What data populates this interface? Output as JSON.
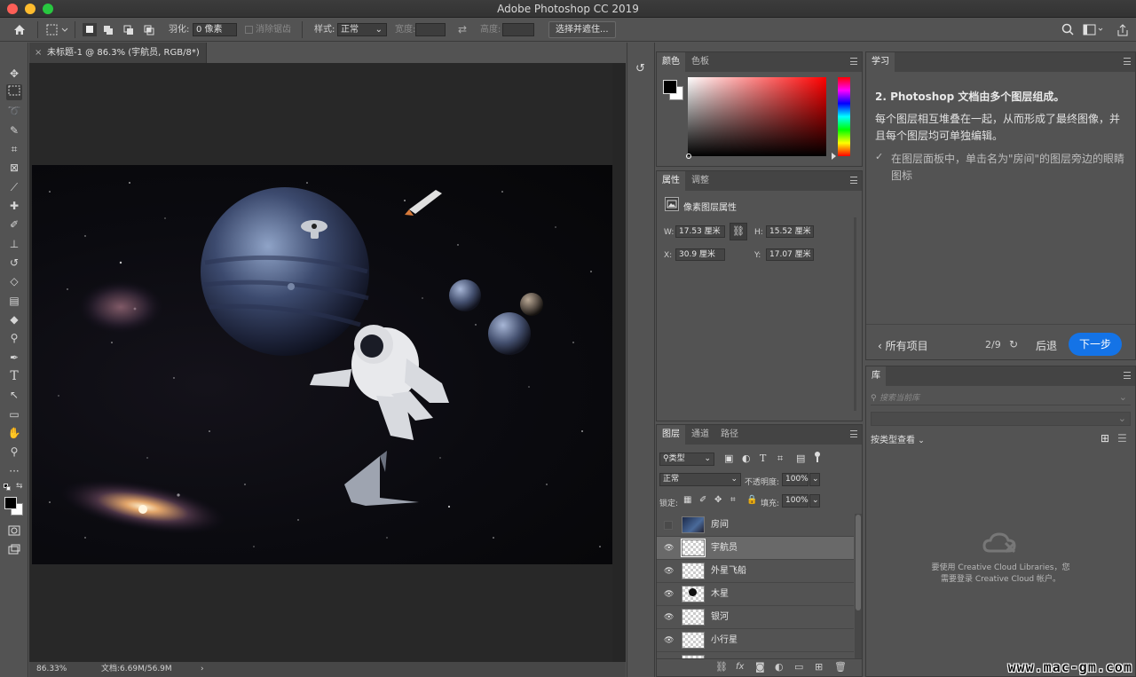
{
  "window": {
    "title": "Adobe Photoshop CC 2019"
  },
  "options": {
    "feather_label": "羽化:",
    "feather_value": "0 像素",
    "antialias_label": "消除锯齿",
    "style_label": "样式:",
    "style_value": "正常",
    "width_label": "宽度:",
    "height_label": "高度:",
    "select_mask_button": "选择并遮住..."
  },
  "document": {
    "tab_title": "未标题-1 @ 86.3% (宇航员, RGB/8*) *",
    "zoom": "86.33%",
    "doc_info": "文档:6.69M/56.9M"
  },
  "color_panel": {
    "tabs": [
      "颜色",
      "色板"
    ],
    "foreground": "#000000",
    "background": "#ffffff",
    "field_hue": "#ff0000"
  },
  "properties_panel": {
    "tabs": [
      "属性",
      "调整"
    ],
    "section_title": "像素图层属性",
    "w_label": "W:",
    "w_value": "17.53 厘米",
    "h_label": "H:",
    "h_value": "15.52 厘米",
    "x_label": "X:",
    "x_value": "30.9 厘米",
    "y_label": "Y:",
    "y_value": "17.07 厘米"
  },
  "layers_panel": {
    "tabs": [
      "图层",
      "通道",
      "路径"
    ],
    "filter_kind": "类型",
    "blend_mode": "正常",
    "opacity_label": "不透明度:",
    "opacity_value": "100%",
    "lock_label": "锁定:",
    "fill_label": "填充:",
    "fill_value": "100%",
    "layers": [
      {
        "name": "房间",
        "visible": false,
        "selected": false
      },
      {
        "name": "宇航员",
        "visible": true,
        "selected": true
      },
      {
        "name": "外星飞船",
        "visible": true,
        "selected": false
      },
      {
        "name": "木星",
        "visible": true,
        "selected": false
      },
      {
        "name": "银河",
        "visible": true,
        "selected": false
      },
      {
        "name": "小行星",
        "visible": true,
        "selected": false
      }
    ]
  },
  "learn_panel": {
    "tab": "学习",
    "step_title": "2.  Photoshop 文档由多个图层组成。",
    "body": "每个图层相互堆叠在一起，从而形成了最终图像，并且每个图层均可单独编辑。",
    "task": "在图层面板中，单击名为\"房间\"的图层旁边的眼睛图标",
    "all_items": "所有项目",
    "progress": "2/9",
    "back": "后退",
    "next": "下一步"
  },
  "library_panel": {
    "tab": "库",
    "search_placeholder": "搜索当前库",
    "view_by": "按类型查看",
    "signin_line1": "要使用 Creative Cloud Libraries，您",
    "signin_line2": "需要登录 Creative Cloud 帐户。"
  },
  "watermark": "www.mac-gm.com"
}
